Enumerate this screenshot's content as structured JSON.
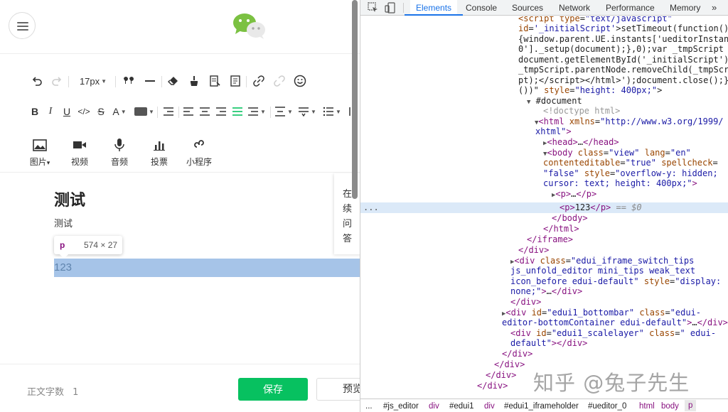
{
  "editor": {
    "toolbar": {
      "font_size": "17px",
      "media": [
        {
          "icon": "image-icon",
          "label": "图片"
        },
        {
          "icon": "video-icon",
          "label": "视频"
        },
        {
          "icon": "audio-icon",
          "label": "音频"
        },
        {
          "icon": "vote-icon",
          "label": "投票"
        },
        {
          "icon": "mini-program-icon",
          "label": "小程序"
        }
      ]
    },
    "content": {
      "heading": "测试",
      "paragraph": "测试",
      "selected_paragraph": "123",
      "inspect_tag": "p",
      "inspect_size": "574 × 27"
    },
    "side_card": [
      "在",
      "续",
      "问",
      "答"
    ],
    "bottom": {
      "word_count_label": "正文字数",
      "word_count": "1",
      "save_label": "保存",
      "preview_label": "预览"
    }
  },
  "devtools": {
    "tabs": [
      "Elements",
      "Console",
      "Sources",
      "Network",
      "Performance",
      "Memory"
    ],
    "active_tab": "Elements",
    "more_tabs": "»",
    "breadcrumbs": [
      "...",
      "#js_editor",
      "div",
      "#edui1",
      "div",
      "#edui1_iframeholder",
      "#ueditor_0",
      "html",
      "body",
      "p"
    ],
    "selected_marker": "== $0",
    "row_ellipsis": "..."
  },
  "watermark": "知乎 @兔子先生",
  "colors": {
    "accent": "#07c160",
    "devtools_blue": "#1a73e8",
    "tag": "#881280"
  }
}
